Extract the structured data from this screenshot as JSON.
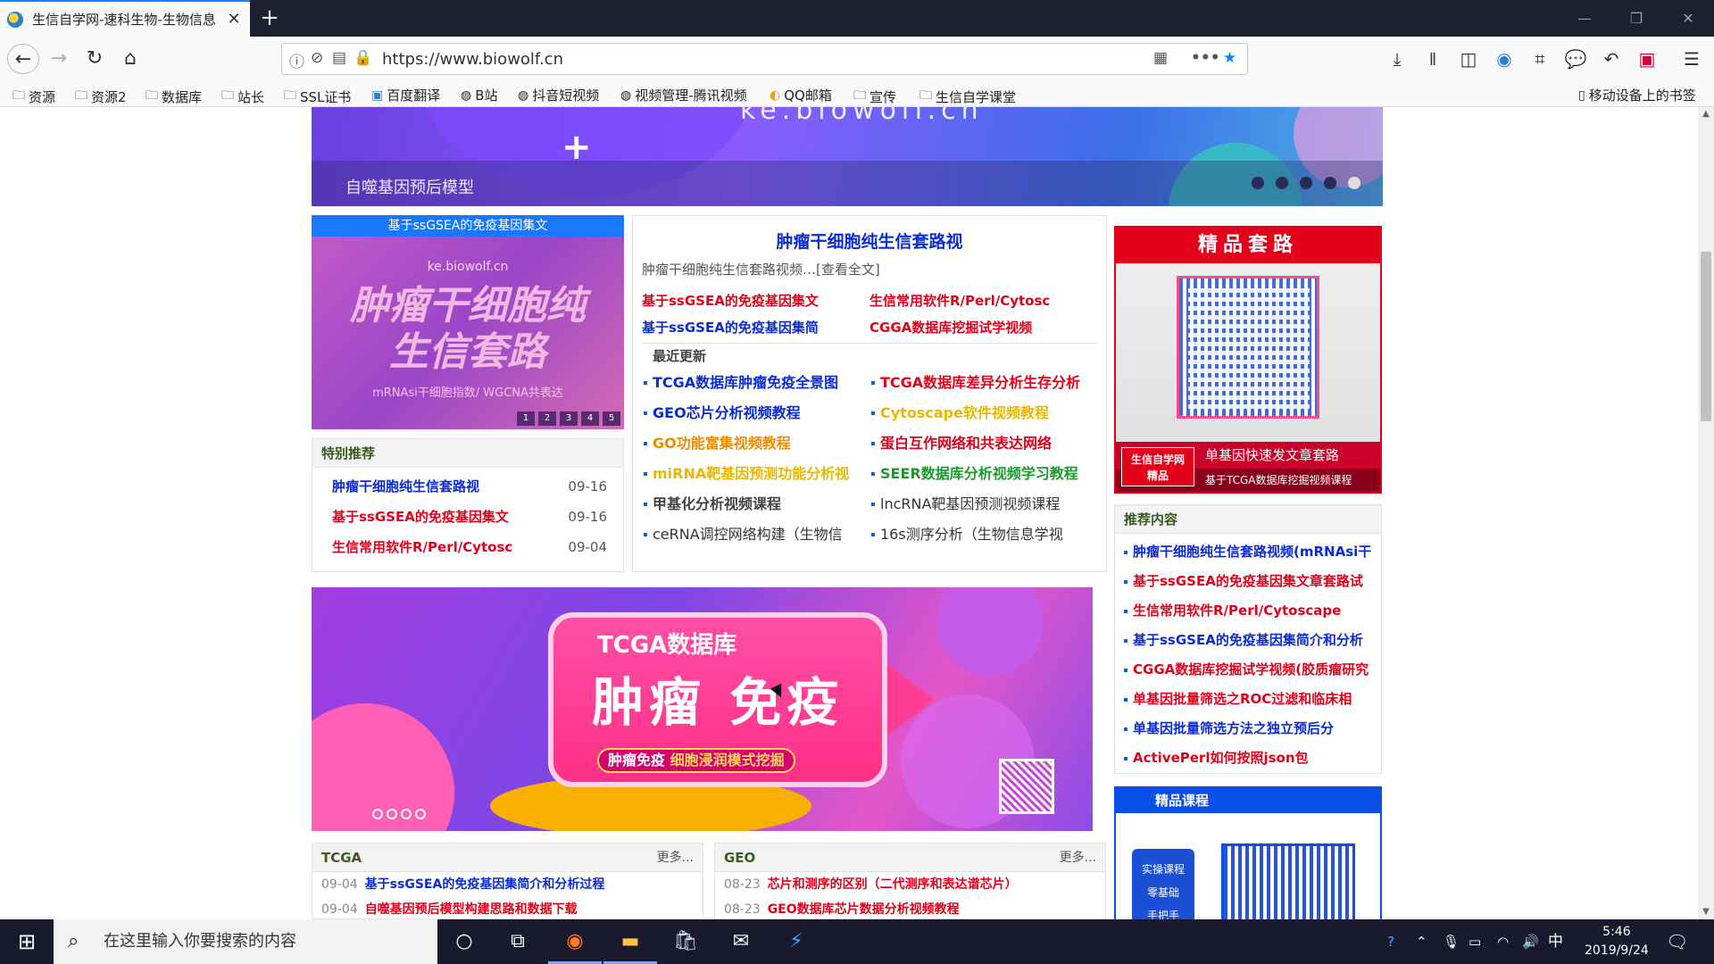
{
  "browser": {
    "tab_title": "生信自学网-速科生物-生物信息",
    "tab_close": "✕",
    "new_tab": "+",
    "url": "https://www.biowolf.cn",
    "win_min": "—",
    "win_max": "❐",
    "win_close": "✕"
  },
  "bookmarks": [
    "资源",
    "资源2",
    "数据库",
    "站长",
    "SSL证书",
    "百度翻译",
    "B站",
    "抖音短视频",
    "视频管理-腾讯视频",
    "QQ邮箱",
    "宣传",
    "生信自学课堂"
  ],
  "mobile_bookmarks": "移动设备上的书签",
  "banner": {
    "caption": "自噬基因预后模型",
    "watermark": "ke.biowolf.cn",
    "plus": "+"
  },
  "promo": {
    "header": "基于ssGSEA的免疫基因集文",
    "site": "ke.biowolf.cn",
    "title": "肿瘤干细胞纯生信套路",
    "sub": "mRNAsi干细胞指数/ WGCNA共表达",
    "pages": [
      "1",
      "2",
      "3",
      "4",
      "5"
    ]
  },
  "special": {
    "title": "特别推荐",
    "items": [
      {
        "text": "肿瘤干细胞纯生信套路视",
        "date": "09-16",
        "color": "blue"
      },
      {
        "text": "基于ssGSEA的免疫基因集文",
        "date": "09-16",
        "color": "red"
      },
      {
        "text": "生信常用软件R/Perl/Cytosc",
        "date": "09-04",
        "color": "red"
      }
    ]
  },
  "featured": {
    "title": "肿瘤干细胞纯生信套路视",
    "summary": "肿瘤干细胞纯生信套路视频…[查看全文]",
    "links": [
      {
        "text": "基于ssGSEA的免疫基因集文",
        "color": "red"
      },
      {
        "text": "生信常用软件R/Perl/Cytosc",
        "color": "red"
      },
      {
        "text": "基于ssGSEA的免疫基因集简",
        "color": "blue"
      },
      {
        "text": "CGGA数据库挖掘试学视频",
        "color": "red"
      }
    ],
    "recent_label": "最近更新",
    "recent": [
      {
        "text": "TCGA数据库肿瘤免疫全景图",
        "color": "blue"
      },
      {
        "text": "TCGA数据库差异分析生存分析",
        "color": "red"
      },
      {
        "text": "GEO芯片分析视频教程",
        "color": "blue"
      },
      {
        "text": "Cytoscape软件视频教程",
        "color": "yellow"
      },
      {
        "text": "GO功能富集视频教程",
        "color": "orange"
      },
      {
        "text": "蛋白互作网络和共表达网络",
        "color": "red"
      },
      {
        "text": "miRNA靶基因预测功能分析视",
        "color": "yellow"
      },
      {
        "text": "SEER数据库分析视频学习教程",
        "color": "green"
      },
      {
        "text": "甲基化分析视频课程",
        "color": "gray"
      },
      {
        "text": "lncRNA靶基因预测视频课程",
        "color": "normal"
      },
      {
        "text": "ceRNA调控网络构建（生物信",
        "color": "normal"
      },
      {
        "text": "16s测序分析（生物信息学视",
        "color": "normal"
      }
    ]
  },
  "qr_card": {
    "title": "精品套路",
    "line1": "单基因快速发文章套路",
    "line2": "基于TCGA数据库挖掘视频课程",
    "tag": "生信自学网\n精品"
  },
  "recommend": {
    "title": "推荐内容",
    "items": [
      {
        "text": "肿瘤干细胞纯生信套路视频(mRNAsi干",
        "color": "blue"
      },
      {
        "text": "基于ssGSEA的免疫基因集文章套路试",
        "color": "red"
      },
      {
        "text": "生信常用软件R/Perl/Cytoscape",
        "color": "red"
      },
      {
        "text": "基于ssGSEA的免疫基因集简介和分析",
        "color": "blue"
      },
      {
        "text": "CGGA数据库挖掘试学视频(胶质瘤研究",
        "color": "red"
      },
      {
        "text": "单基因批量筛选之ROC过滤和临床相",
        "color": "red"
      },
      {
        "text": "单基因批量筛选方法之独立预后分",
        "color": "blue"
      },
      {
        "text": "ActivePerl如何按照json包",
        "color": "red"
      }
    ]
  },
  "course": {
    "title": "精品课程",
    "side": "实操课程\n零基础\n手把手"
  },
  "tcga_banner": {
    "line1": "TCGA数据库",
    "line2": "肿瘤 免疫",
    "tag1": "肿瘤免疫",
    "tag2": "细胞浸润模式挖掘"
  },
  "tcga_box": {
    "title": "TCGA",
    "more": "更多...",
    "items": [
      {
        "date": "09-04",
        "text": "基于ssGSEA的免疫基因集简介和分析过程",
        "color": "blue"
      },
      {
        "date": "09-04",
        "text": "自噬基因预后模型构建思路和数据下载",
        "color": "red"
      }
    ]
  },
  "geo_box": {
    "title": "GEO",
    "more": "更多...",
    "items": [
      {
        "date": "08-23",
        "text": "芯片和测序的区别（二代测序和表达谱芯片）",
        "color": "red"
      },
      {
        "date": "08-23",
        "text": "GEO数据库芯片数据分析视频教程",
        "color": "red"
      }
    ]
  },
  "taskbar": {
    "search_placeholder": "在这里输入你要搜索的内容",
    "ime": "中",
    "time": "5:46",
    "date": "2019/9/24"
  }
}
